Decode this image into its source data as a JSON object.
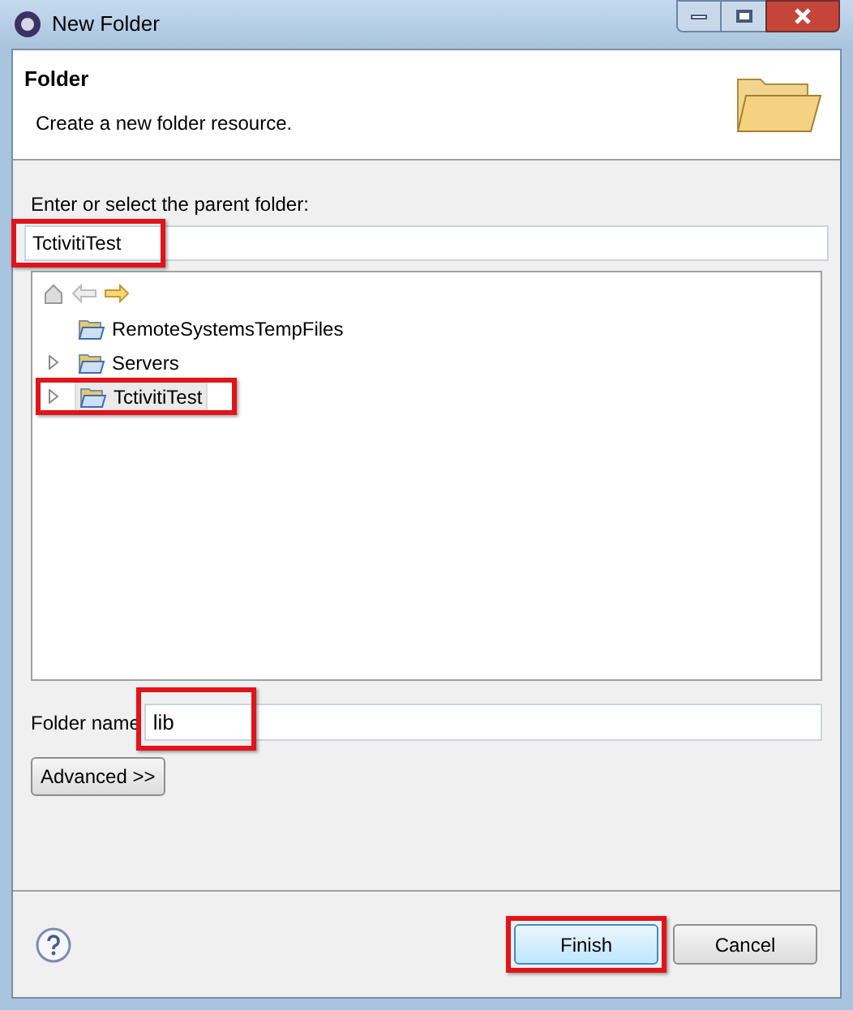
{
  "window": {
    "title": "New Folder"
  },
  "header": {
    "title": "Folder",
    "description": "Create a new folder resource."
  },
  "parent_folder": {
    "label": "Enter or select the parent folder:",
    "value": "TctivitiTest",
    "highlighted": true
  },
  "tree": {
    "items": [
      {
        "label": "RemoteSystemsTempFiles",
        "expandable": false,
        "selected": false,
        "highlighted": false
      },
      {
        "label": "Servers",
        "expandable": true,
        "selected": false,
        "highlighted": false
      },
      {
        "label": "TctivitiTest",
        "expandable": true,
        "selected": true,
        "highlighted": true
      }
    ]
  },
  "folder_name": {
    "label": "Folder name",
    "value": "lib",
    "highlighted": true
  },
  "advanced_button": {
    "label": "Advanced >>"
  },
  "buttons": [
    {
      "label": "Finish",
      "default": true,
      "highlighted": true
    },
    {
      "label": "Cancel",
      "default": false,
      "highlighted": false
    }
  ]
}
